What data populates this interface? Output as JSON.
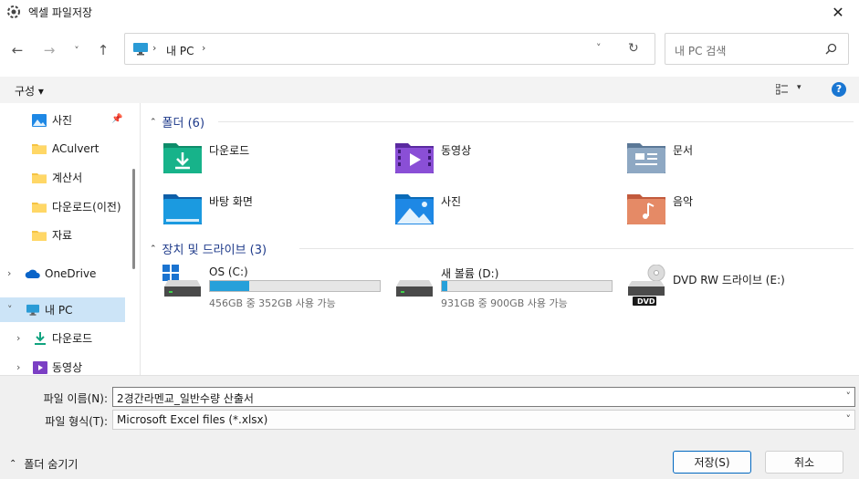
{
  "window": {
    "title": "엑셀 파일저장",
    "close_glyph": "✕"
  },
  "nav": {
    "back": "←",
    "forward": "→",
    "recent": "˅",
    "up": "↑",
    "address": {
      "location": "내 PC",
      "chevron": "›",
      "dropdown": "˅",
      "refresh": "↻"
    },
    "search": {
      "placeholder": "내 PC 검색"
    }
  },
  "toolbar": {
    "organize_label": "구성 ▾",
    "view_dropdown": "▾",
    "help_label": "?"
  },
  "sidebar": {
    "items": [
      {
        "label": "사진",
        "icon": "pictures-icon",
        "pinned": true
      },
      {
        "label": "ACulvert",
        "icon": "folder-icon"
      },
      {
        "label": "계산서",
        "icon": "folder-icon"
      },
      {
        "label": "다운로드(이전)",
        "icon": "folder-icon"
      },
      {
        "label": "자료",
        "icon": "folder-icon"
      },
      {
        "label": "OneDrive",
        "icon": "cloud-icon",
        "chevron": "›"
      },
      {
        "label": "내 PC",
        "icon": "pc-icon",
        "chevron": "˅",
        "selected": true
      },
      {
        "label": "다운로드",
        "icon": "download-icon",
        "chevron": "›"
      },
      {
        "label": "동영상",
        "icon": "video-icon",
        "chevron": "›"
      }
    ]
  },
  "content": {
    "folders_header": "폴더 (6)",
    "folders": [
      {
        "label": "다운로드",
        "icon": "downloads-folder-icon"
      },
      {
        "label": "동영상",
        "icon": "videos-folder-icon"
      },
      {
        "label": "문서",
        "icon": "documents-folder-icon"
      },
      {
        "label": "바탕 화면",
        "icon": "desktop-folder-icon"
      },
      {
        "label": "사진",
        "icon": "pictures-folder-icon"
      },
      {
        "label": "음악",
        "icon": "music-folder-icon"
      }
    ],
    "drives_header": "장치 및 드라이브 (3)",
    "drives": [
      {
        "label": "OS (C:)",
        "free": "456GB 중 352GB 사용 가능",
        "used_fraction": 0.23,
        "icon": "windows-drive-icon"
      },
      {
        "label": "새 볼륨 (D:)",
        "free": "931GB 중 900GB 사용 가능",
        "used_fraction": 0.03,
        "icon": "hard-drive-icon"
      },
      {
        "label": "DVD RW 드라이브 (E:)",
        "badge": "DVD",
        "icon": "dvd-drive-icon"
      }
    ]
  },
  "form": {
    "filename_label": "파일 이름(N):",
    "filename_value": "2경간라멘교_일반수량 산출서",
    "filetype_label": "파일 형식(T):",
    "filetype_value": "Microsoft Excel files (*.xlsx)",
    "dropdown": "˅",
    "hide_folders_label": "폴더 숨기기",
    "hide_folders_chevron": "⌃",
    "save_label": "저장(S)",
    "cancel_label": "취소"
  },
  "colors": {
    "accent": "#0067c0",
    "selected": "#cce4f7",
    "progress": "#26a0da",
    "header_text": "#1e3a8a"
  }
}
